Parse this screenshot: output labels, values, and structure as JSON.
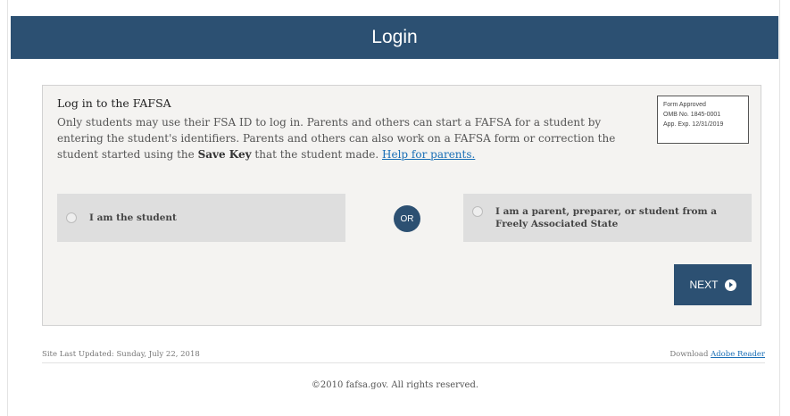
{
  "header": {
    "title": "Login"
  },
  "card": {
    "heading": "Log in to the FAFSA",
    "body_intro": "Only students may use their FSA ID to log in. Parents and others can start a FAFSA for a student by entering the student's identifiers. Parents and others can also work on a FAFSA form or correction the student started using the ",
    "save_key": "Save Key",
    "body_outro": " that the student made. ",
    "help_link": "Help for parents.",
    "omb": {
      "line1": "Form Approved",
      "line2": "OMB No. 1845-0001",
      "line3": "App. Exp. 12/31/2019"
    },
    "option_student": "I am the student",
    "or_label": "OR",
    "option_parent": "I am a parent, preparer, or student from a Freely Associated State",
    "next_label": "NEXT"
  },
  "footer": {
    "site_updated": "Site Last Updated: Sunday, July 22, 2018",
    "download_prefix": "Download ",
    "adobe_link": "Adobe Reader",
    "copyright": "©2010 fafsa.gov. All rights reserved."
  },
  "colors": {
    "header_bg": "#2c5072",
    "card_bg": "#f4f3f1",
    "option_bg": "#dedede",
    "link": "#1a6fb6"
  }
}
